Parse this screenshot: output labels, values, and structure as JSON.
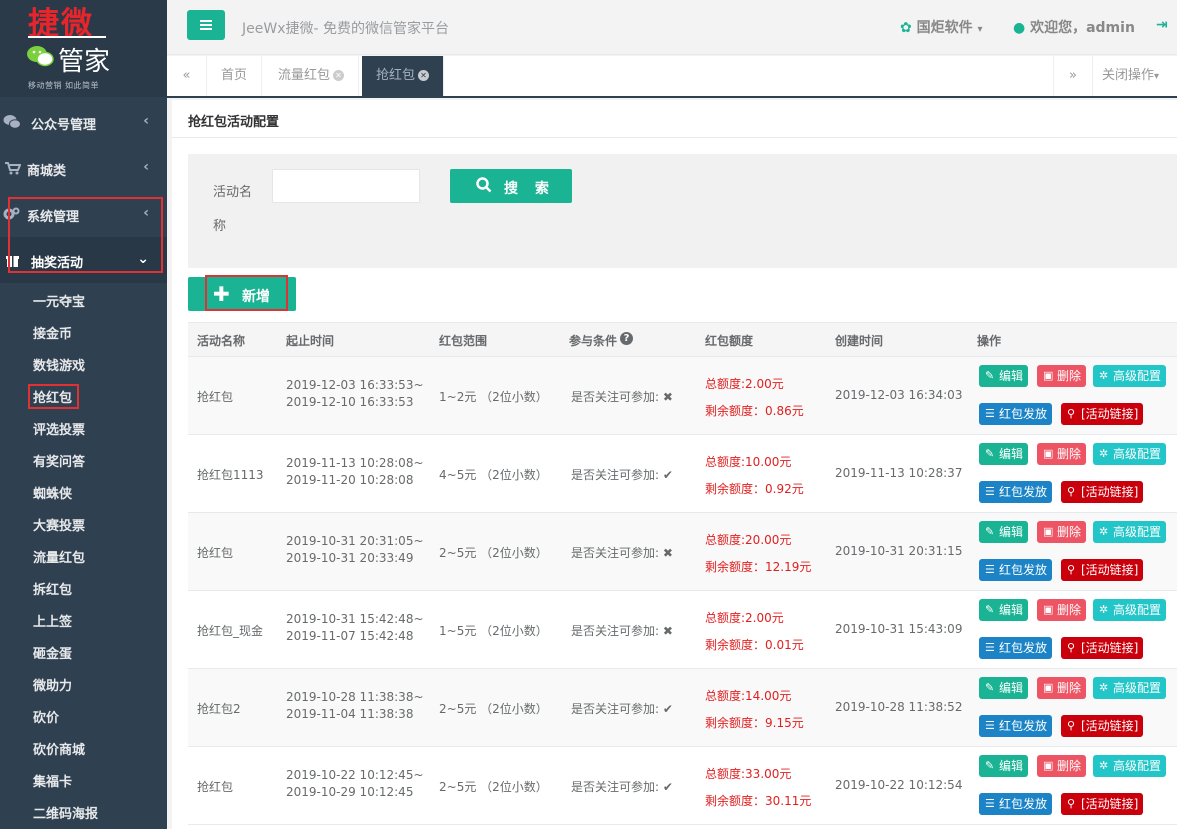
{
  "logo": {
    "top_text": "捷微",
    "brand_text": "管家",
    "slogan": "移动营销 如此简单"
  },
  "sidebar": {
    "menus": [
      {
        "label": "公众号管理",
        "icon": "wechat-icon"
      },
      {
        "label": "商城类",
        "icon": "cart-icon"
      },
      {
        "label": "系统管理",
        "icon": "gear-icon"
      },
      {
        "label": "抽奖活动",
        "icon": "gift-icon"
      }
    ],
    "sub_items": [
      "一元夺宝",
      "接金币",
      "数钱游戏",
      "抢红包",
      "评选投票",
      "有奖问答",
      "蜘蛛侠",
      "大赛投票",
      "流量红包",
      "拆红包",
      "上上签",
      "砸金蛋",
      "微助力",
      "砍价",
      "砍价商城",
      "集福卡",
      "二维码海报"
    ]
  },
  "topbar": {
    "site_title": "JeeWx捷微- 免费的微信管家平台",
    "software_menu": "国炬软件",
    "welcome": "欢迎您，admin"
  },
  "tabs": {
    "items": [
      "首页",
      "流量红包",
      "抢红包"
    ],
    "close_ops": "关闭操作"
  },
  "panel": {
    "title": "抢红包活动配置"
  },
  "search": {
    "label": "活动名称",
    "button": "搜 索",
    "value": ""
  },
  "add_button": "新增",
  "table": {
    "headers": [
      "活动名称",
      "起止时间",
      "红包范围",
      "参与条件",
      "红包额度",
      "创建时间",
      "操作"
    ],
    "action_labels": {
      "edit": "编辑",
      "delete": "删除",
      "advanced": "高级配置",
      "send": "红包发放",
      "link": "[活动链接]"
    },
    "cond_label": "是否关注可参加:",
    "rows": [
      {
        "name": "抢红包",
        "start": "2019-12-03 16:33:53~",
        "end": "2019-12-10 16:33:53",
        "range": "1~2元 （2位小数）",
        "cond": "✖",
        "total": "总额度:2.00元",
        "remain": "剩余额度：0.86元",
        "created": "2019-12-03 16:34:03"
      },
      {
        "name": "抢红包1113",
        "start": "2019-11-13 10:28:08~",
        "end": "2019-11-20 10:28:08",
        "range": "4~5元 （2位小数）",
        "cond": "✔",
        "total": "总额度:10.00元",
        "remain": "剩余额度：0.92元",
        "created": "2019-11-13 10:28:37"
      },
      {
        "name": "抢红包",
        "start": "2019-10-31 20:31:05~",
        "end": "2019-10-31 20:33:49",
        "range": "2~5元 （2位小数）",
        "cond": "✖",
        "total": "总额度:20.00元",
        "remain": "剩余额度：12.19元",
        "created": "2019-10-31 20:31:15"
      },
      {
        "name": "抢红包_现金",
        "start": "2019-10-31 15:42:48~",
        "end": "2019-11-07 15:42:48",
        "range": "1~5元 （2位小数）",
        "cond": "✖",
        "total": "总额度:2.00元",
        "remain": "剩余额度：0.01元",
        "created": "2019-10-31 15:43:09"
      },
      {
        "name": "抢红包2",
        "start": "2019-10-28 11:38:38~",
        "end": "2019-11-04 11:38:38",
        "range": "2~5元 （2位小数）",
        "cond": "✔",
        "total": "总额度:14.00元",
        "remain": "剩余额度：9.15元",
        "created": "2019-10-28 11:38:52"
      },
      {
        "name": "抢红包",
        "start": "2019-10-22 10:12:45~",
        "end": "2019-10-29 10:12:45",
        "range": "2~5元 （2位小数）",
        "cond": "✔",
        "total": "总额度:33.00元",
        "remain": "剩余额度：30.11元",
        "created": "2019-10-22 10:12:54"
      }
    ]
  }
}
